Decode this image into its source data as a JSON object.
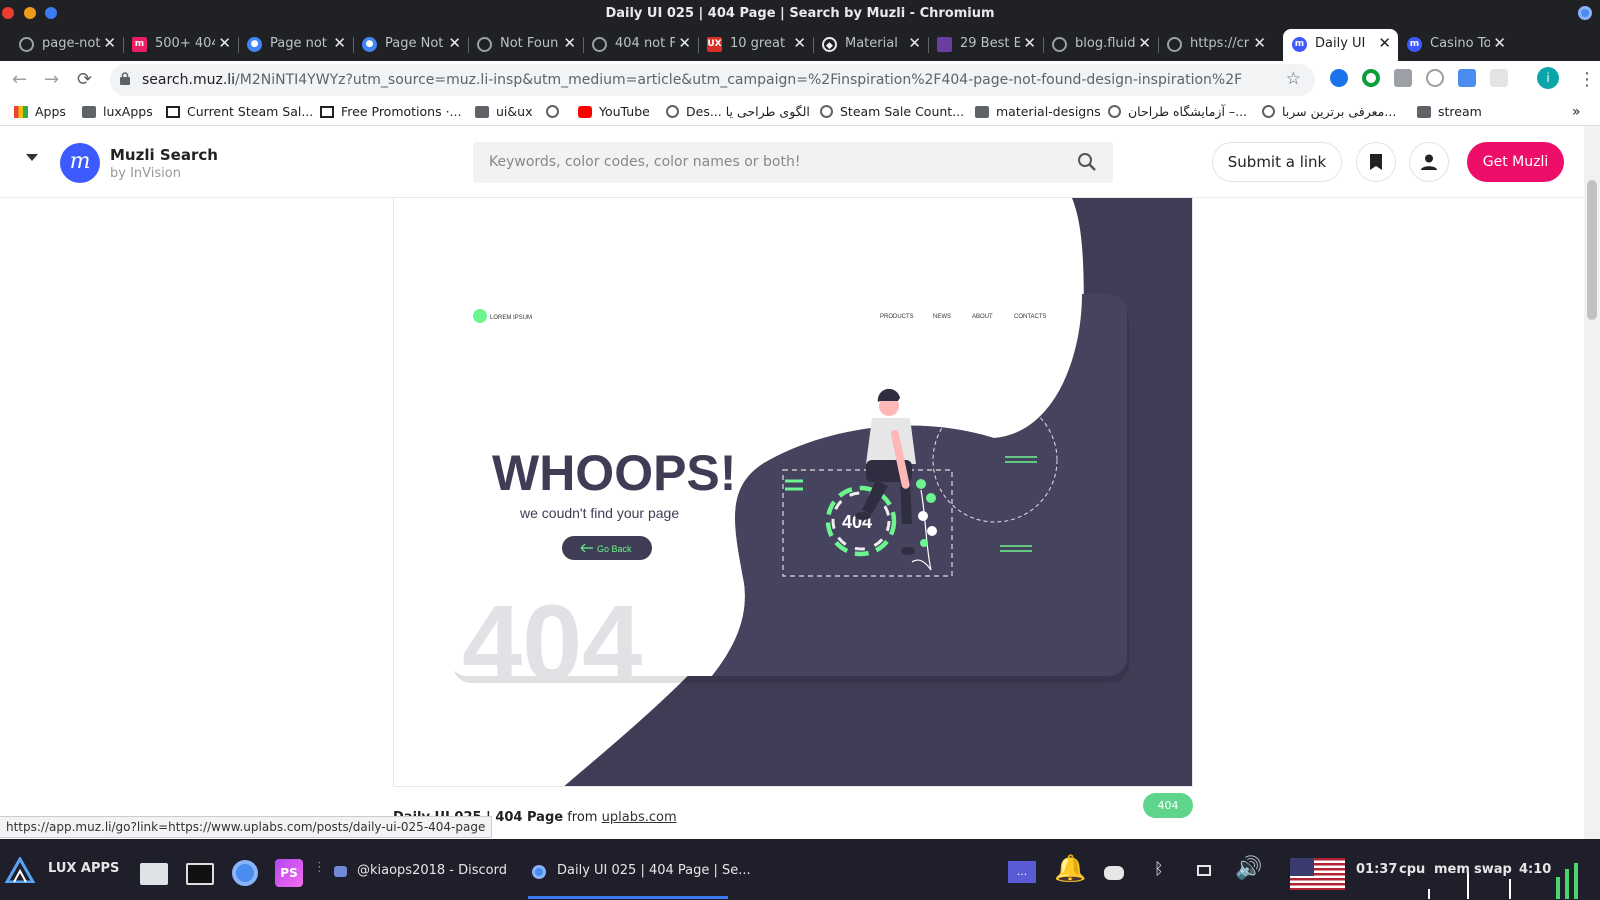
{
  "window": {
    "title": "Daily UI 025 | 404 Page | Search by Muzli - Chromium"
  },
  "tabs": [
    {
      "label": "page-not",
      "fav": "#9aa0a6"
    },
    {
      "label": "500+ 404",
      "fav": "#e91e63"
    },
    {
      "label": "Page not",
      "fav": "#4285f4"
    },
    {
      "label": "Page Not",
      "fav": "#4285f4"
    },
    {
      "label": "Not Foun",
      "fav": "#9aa0a6"
    },
    {
      "label": "404 not F",
      "fav": "#9aa0a6"
    },
    {
      "label": "10 great",
      "fav": "#d93025"
    },
    {
      "label": "Material",
      "fav": "#202124"
    },
    {
      "label": "29 Best E",
      "fav": "#6a3ea1"
    },
    {
      "label": "blog.fluid",
      "fav": "#9aa0a6"
    },
    {
      "label": "https://cr",
      "fav": "#9aa0a6"
    },
    {
      "label": "Daily UI",
      "fav": "#3d5afe"
    },
    {
      "label": "Casino To",
      "fav": "#3d5afe"
    }
  ],
  "toolbar": {
    "url_host": "search.muz.li",
    "url_path": "/M2NiNTI4YWYz?utm_source=muz.li-insp&utm_medium=article&utm_campaign=%2Finspiration%2F404-page-not-found-design-inspiration%2F",
    "profile_initial": "i"
  },
  "bookmarks": [
    {
      "label": "Apps",
      "icon": "apps-grid"
    },
    {
      "label": "luxApps",
      "icon": "folder"
    },
    {
      "label": "Current Steam Sal...",
      "icon": "steam"
    },
    {
      "label": "Free Promotions ·...",
      "icon": "steam"
    },
    {
      "label": "ui&ux",
      "icon": "folder"
    },
    {
      "label": "",
      "icon": "globe"
    },
    {
      "label": "YouTube",
      "icon": "youtube"
    },
    {
      "label": "Des... الگوی طراحی یا",
      "icon": "globe"
    },
    {
      "label": "Steam Sale Count...",
      "icon": "globe"
    },
    {
      "label": "material-designs",
      "icon": "folder"
    },
    {
      "label": "آزمایشگاه طراحان –...",
      "icon": "globe"
    },
    {
      "label": "معرفی برترین سربا...",
      "icon": "globe"
    },
    {
      "label": "stream",
      "icon": "folder"
    }
  ],
  "header": {
    "brand": "Muzli Search",
    "brand_sub": "by InVision",
    "logo_letter": "m",
    "search_placeholder": "Keywords, color codes, color names or both!",
    "submit_label": "Submit a link",
    "cta_label": "Get Muzli"
  },
  "shot": {
    "mock_logo": "LOREM IPSUM",
    "mock_nav": [
      "PRODUCTS",
      "NEWS",
      "ABOUT",
      "CONTACTS"
    ],
    "headline": "WHOOPS!",
    "subline": "we coudn't find your page",
    "button": "Go Back",
    "big_number": "404",
    "badge_number": "404"
  },
  "caption": {
    "title": "Daily UI 025 | 404 Page",
    "from": "from",
    "source": "uplabs.com",
    "tag": "404"
  },
  "status_url": "https://app.muz.li/go?link=https://www.uplabs.com/posts/daily-ui-025-404-page",
  "taskbar": {
    "launcher": "LUX APPS",
    "discord": "@kiaops2018 - Discord",
    "chromium": "Daily UI 025 | 404 Page | Se...",
    "clock": "01:37",
    "cpu": "cpu",
    "mem": "mem",
    "swap": "swap",
    "battery": "4:10",
    "window_btn": "..."
  },
  "colors": {
    "brand_pink": "#ee0d68",
    "muzli_blue": "#3d5afe",
    "illustration_dark": "#3f3d56",
    "accent_green": "#6cf58f"
  }
}
